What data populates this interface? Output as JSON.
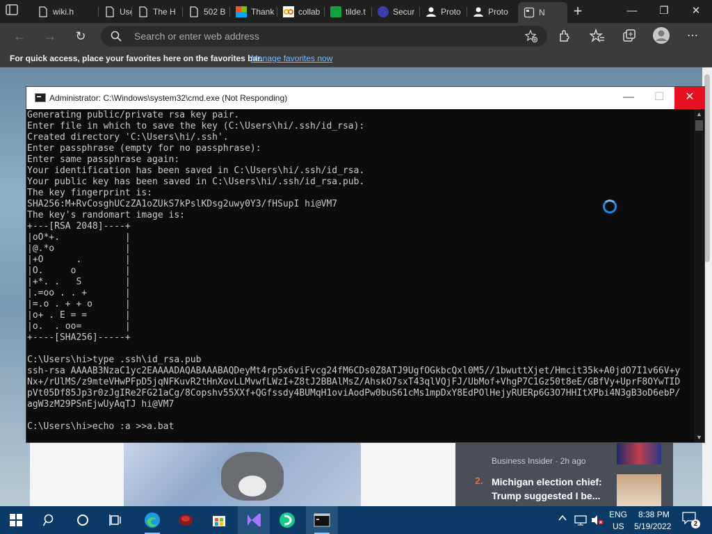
{
  "browser": {
    "tabs": [
      {
        "label": "wiki.h",
        "icon": "document-icon"
      },
      {
        "label": "User:",
        "icon": "document-icon"
      },
      {
        "label": "The H",
        "icon": "document-icon"
      },
      {
        "label": "502 B",
        "icon": "document-icon"
      },
      {
        "label": "Thank",
        "icon": "microsoft-logo-icon"
      },
      {
        "label": "collab",
        "icon": "colab-icon"
      },
      {
        "label": "tilde.t",
        "icon": "tilde-icon"
      },
      {
        "label": "Secur",
        "icon": "shield-icon"
      },
      {
        "label": "Proto",
        "icon": "person-icon"
      },
      {
        "label": "Proto",
        "icon": "person-icon"
      },
      {
        "label": "N",
        "icon": "newtab-icon"
      }
    ],
    "address_placeholder": "Search or enter web address",
    "favorites_bar": {
      "message": "For quick access, place your favorites here on the favorites bar.",
      "link": "Manage favorites now"
    }
  },
  "news": {
    "source": "Business Insider · 2h ago",
    "item_number": "2.",
    "item_title": "Michigan election chief: Trump suggested I be..."
  },
  "cmd": {
    "title": "Administrator: C:\\Windows\\system32\\cmd.exe (Not Responding)",
    "lines": [
      "Generating public/private rsa key pair.",
      "Enter file in which to save the key (C:\\Users\\hi/.ssh/id_rsa):",
      "Created directory 'C:\\Users\\hi/.ssh'.",
      "Enter passphrase (empty for no passphrase):",
      "Enter same passphrase again:",
      "Your identification has been saved in C:\\Users\\hi/.ssh/id_rsa.",
      "Your public key has been saved in C:\\Users\\hi/.ssh/id_rsa.pub.",
      "The key fingerprint is:",
      "SHA256:M+RvCosghUCzZA1oZUkS7kPslKDsg2uwy0Y3/fHSupI hi@VM7",
      "The key's randomart image is:",
      "+---[RSA 2048]----+",
      "|oO*+.            |",
      "|@.*o             |",
      "|+O      .        |",
      "|O.     o         |",
      "|+*. .   S        |",
      "|.=oo . . +       |",
      "|=.o . + + o      |",
      "|o+ . E = =       |",
      "|o.  . oo=        |",
      "+----[SHA256]-----+",
      "",
      "C:\\Users\\hi>type .ssh\\id_rsa.pub",
      "ssh-rsa AAAAB3NzaC1yc2EAAAADAQABAAABAQDeyMt4rp5x6viFvcg24fM6CDs0Z8ATJ9UgfOGkbcQxl0M5//1bwuttXjet/Hmcit35k+A0jdO7I1v66V+y",
      "Nx+/rUlMS/z9mteVHwPFpD5jqNFKuvR2tHnXovLLMvwfLWzI+Z8tJ2BBAlMsZ/AhskO7sxT43qlVQjFJ/UbMof+VhgP7C1Gz50t8eE/GBfVy+UprF8OYwTID",
      "pVt05Df85Jp3r0zJgIRe2FG21aCg/8Copshv55XXf+QGfssdy4BUMqH1oviAodPw0buS61cMs1mpDxY8EdPOlHejyRUERp6G3O7HHItXPbi4N3gB3oD6ebP/",
      "agW3zM29PSnEjwUyAqTJ hi@VM7",
      "",
      "C:\\Users\\hi>echo :a >>a.bat"
    ]
  },
  "tray": {
    "language_top": "ENG",
    "language_bottom": "US",
    "time": "8:38 PM",
    "date": "5/19/2022",
    "notification_count": "2"
  }
}
